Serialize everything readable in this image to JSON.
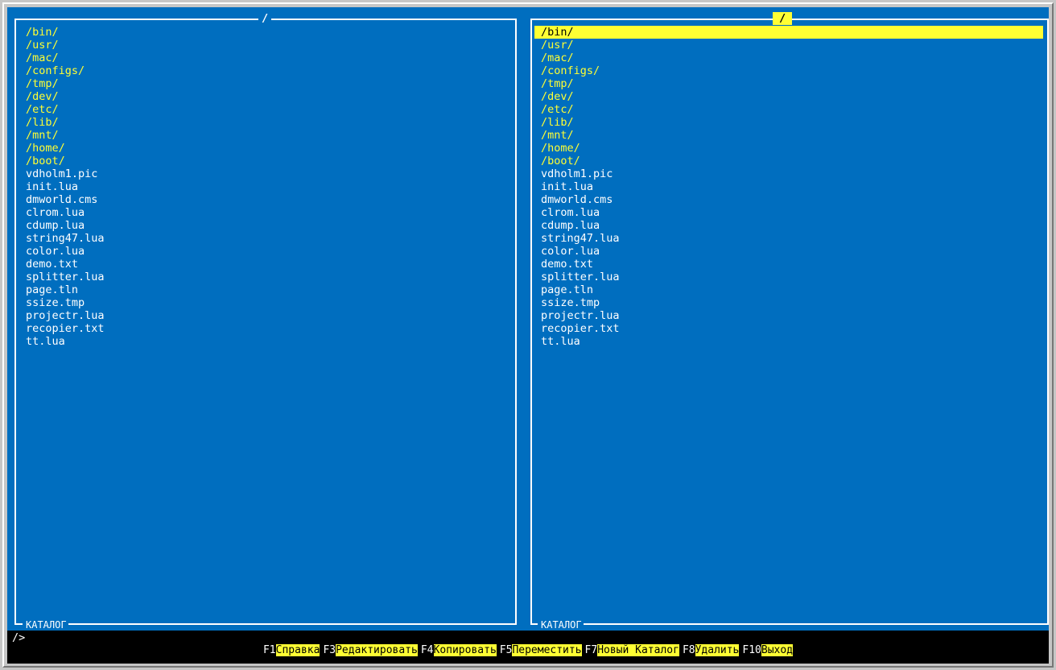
{
  "left_panel": {
    "title": "/",
    "footer": "КАТАЛОГ",
    "items": [
      {
        "name": "/bin/",
        "type": "dir"
      },
      {
        "name": "/usr/",
        "type": "dir"
      },
      {
        "name": "/mac/",
        "type": "dir"
      },
      {
        "name": "/configs/",
        "type": "dir"
      },
      {
        "name": "/tmp/",
        "type": "dir"
      },
      {
        "name": "/dev/",
        "type": "dir"
      },
      {
        "name": "/etc/",
        "type": "dir"
      },
      {
        "name": "/lib/",
        "type": "dir"
      },
      {
        "name": "/mnt/",
        "type": "dir"
      },
      {
        "name": "/home/",
        "type": "dir"
      },
      {
        "name": "/boot/",
        "type": "dir"
      },
      {
        "name": "vdholm1.pic",
        "type": "file"
      },
      {
        "name": "init.lua",
        "type": "file"
      },
      {
        "name": "dmworld.cms",
        "type": "file"
      },
      {
        "name": "clrom.lua",
        "type": "file"
      },
      {
        "name": "cdump.lua",
        "type": "file"
      },
      {
        "name": "string47.lua",
        "type": "file"
      },
      {
        "name": "color.lua",
        "type": "file"
      },
      {
        "name": "demo.txt",
        "type": "file"
      },
      {
        "name": "splitter.lua",
        "type": "file"
      },
      {
        "name": "page.tln",
        "type": "file"
      },
      {
        "name": "ssize.tmp",
        "type": "file"
      },
      {
        "name": "projectr.lua",
        "type": "file"
      },
      {
        "name": "recopier.txt",
        "type": "file"
      },
      {
        "name": "tt.lua",
        "type": "file"
      }
    ]
  },
  "right_panel": {
    "title": "/",
    "footer": "КАТАЛОГ",
    "selected_index": 0,
    "items": [
      {
        "name": "/bin/",
        "type": "dir"
      },
      {
        "name": "/usr/",
        "type": "dir"
      },
      {
        "name": "/mac/",
        "type": "dir"
      },
      {
        "name": "/configs/",
        "type": "dir"
      },
      {
        "name": "/tmp/",
        "type": "dir"
      },
      {
        "name": "/dev/",
        "type": "dir"
      },
      {
        "name": "/etc/",
        "type": "dir"
      },
      {
        "name": "/lib/",
        "type": "dir"
      },
      {
        "name": "/mnt/",
        "type": "dir"
      },
      {
        "name": "/home/",
        "type": "dir"
      },
      {
        "name": "/boot/",
        "type": "dir"
      },
      {
        "name": "vdholm1.pic",
        "type": "file"
      },
      {
        "name": "init.lua",
        "type": "file"
      },
      {
        "name": "dmworld.cms",
        "type": "file"
      },
      {
        "name": "clrom.lua",
        "type": "file"
      },
      {
        "name": "cdump.lua",
        "type": "file"
      },
      {
        "name": "string47.lua",
        "type": "file"
      },
      {
        "name": "color.lua",
        "type": "file"
      },
      {
        "name": "demo.txt",
        "type": "file"
      },
      {
        "name": "splitter.lua",
        "type": "file"
      },
      {
        "name": "page.tln",
        "type": "file"
      },
      {
        "name": "ssize.tmp",
        "type": "file"
      },
      {
        "name": "projectr.lua",
        "type": "file"
      },
      {
        "name": "recopier.txt",
        "type": "file"
      },
      {
        "name": "tt.lua",
        "type": "file"
      }
    ]
  },
  "command_line": {
    "prompt": "/>"
  },
  "function_keys": [
    {
      "key": "F1",
      "label": "Справка"
    },
    {
      "key": "F3",
      "label": "Редактировать"
    },
    {
      "key": "F4",
      "label": "Копировать"
    },
    {
      "key": "F5",
      "label": "Переместить"
    },
    {
      "key": "F7",
      "label": "Новый Каталог"
    },
    {
      "key": "F8",
      "label": "Удалить"
    },
    {
      "key": "F10",
      "label": "Выход"
    }
  ],
  "colors": {
    "panel_bg": "#006ebf",
    "dir_text": "#ffff33",
    "file_text": "#ffffff",
    "highlight_bg": "#ffff33",
    "screen_bg": "#000000"
  }
}
